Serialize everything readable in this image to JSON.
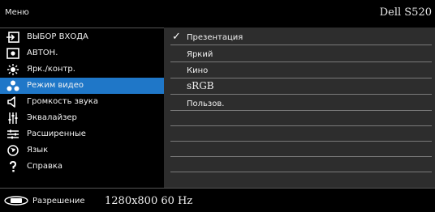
{
  "header": {
    "menu_title": "Меню",
    "model": "Dell S520"
  },
  "menu": {
    "items": [
      {
        "label": "ВЫБОР ВХОДА",
        "icon": "input-source-icon"
      },
      {
        "label": "АВТОН.",
        "icon": "auto-adjust-icon"
      },
      {
        "label": "Ярк./контр.",
        "icon": "brightness-icon"
      },
      {
        "label": "Режим видео",
        "icon": "video-mode-icon",
        "active": true
      },
      {
        "label": "Громкость звука",
        "icon": "speaker-icon"
      },
      {
        "label": "Эквалайзер",
        "icon": "equalizer-icon"
      },
      {
        "label": "Расширенные",
        "icon": "advanced-settings-icon"
      },
      {
        "label": "Язык",
        "icon": "language-icon"
      },
      {
        "label": "Справка",
        "icon": "help-icon"
      }
    ]
  },
  "panel": {
    "options": [
      {
        "label": "Презентация",
        "selected": true
      },
      {
        "label": "Яркий"
      },
      {
        "label": "Кино"
      },
      {
        "label": "sRGB"
      },
      {
        "label": "Пользов."
      }
    ],
    "check_glyph": "✓"
  },
  "footer": {
    "label": "Разрешение",
    "value": "1280x800 60 Hz",
    "icon": "display-icon"
  },
  "colors": {
    "accent": "#1f77c8",
    "panel_bg": "#2d2d2d"
  }
}
